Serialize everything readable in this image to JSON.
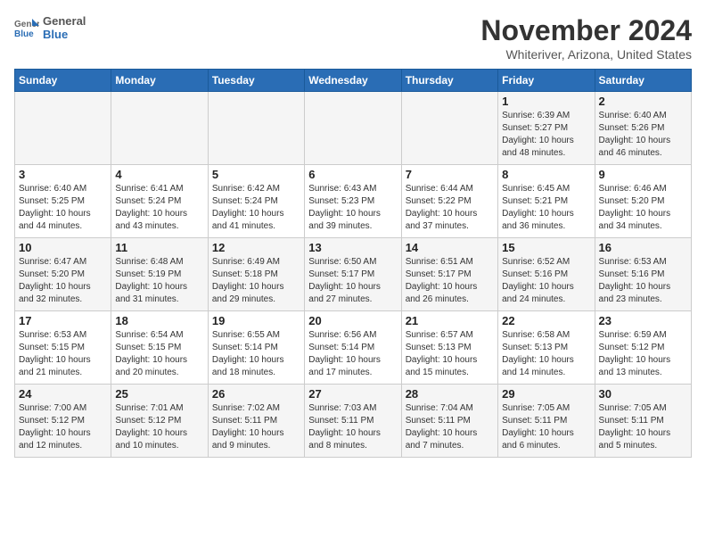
{
  "header": {
    "logo_general": "General",
    "logo_blue": "Blue",
    "month": "November 2024",
    "location": "Whiteriver, Arizona, United States"
  },
  "days_of_week": [
    "Sunday",
    "Monday",
    "Tuesday",
    "Wednesday",
    "Thursday",
    "Friday",
    "Saturday"
  ],
  "weeks": [
    [
      {
        "day": "",
        "info": ""
      },
      {
        "day": "",
        "info": ""
      },
      {
        "day": "",
        "info": ""
      },
      {
        "day": "",
        "info": ""
      },
      {
        "day": "",
        "info": ""
      },
      {
        "day": "1",
        "info": "Sunrise: 6:39 AM\nSunset: 5:27 PM\nDaylight: 10 hours and 48 minutes."
      },
      {
        "day": "2",
        "info": "Sunrise: 6:40 AM\nSunset: 5:26 PM\nDaylight: 10 hours and 46 minutes."
      }
    ],
    [
      {
        "day": "3",
        "info": "Sunrise: 6:40 AM\nSunset: 5:25 PM\nDaylight: 10 hours and 44 minutes."
      },
      {
        "day": "4",
        "info": "Sunrise: 6:41 AM\nSunset: 5:24 PM\nDaylight: 10 hours and 43 minutes."
      },
      {
        "day": "5",
        "info": "Sunrise: 6:42 AM\nSunset: 5:24 PM\nDaylight: 10 hours and 41 minutes."
      },
      {
        "day": "6",
        "info": "Sunrise: 6:43 AM\nSunset: 5:23 PM\nDaylight: 10 hours and 39 minutes."
      },
      {
        "day": "7",
        "info": "Sunrise: 6:44 AM\nSunset: 5:22 PM\nDaylight: 10 hours and 37 minutes."
      },
      {
        "day": "8",
        "info": "Sunrise: 6:45 AM\nSunset: 5:21 PM\nDaylight: 10 hours and 36 minutes."
      },
      {
        "day": "9",
        "info": "Sunrise: 6:46 AM\nSunset: 5:20 PM\nDaylight: 10 hours and 34 minutes."
      }
    ],
    [
      {
        "day": "10",
        "info": "Sunrise: 6:47 AM\nSunset: 5:20 PM\nDaylight: 10 hours and 32 minutes."
      },
      {
        "day": "11",
        "info": "Sunrise: 6:48 AM\nSunset: 5:19 PM\nDaylight: 10 hours and 31 minutes."
      },
      {
        "day": "12",
        "info": "Sunrise: 6:49 AM\nSunset: 5:18 PM\nDaylight: 10 hours and 29 minutes."
      },
      {
        "day": "13",
        "info": "Sunrise: 6:50 AM\nSunset: 5:17 PM\nDaylight: 10 hours and 27 minutes."
      },
      {
        "day": "14",
        "info": "Sunrise: 6:51 AM\nSunset: 5:17 PM\nDaylight: 10 hours and 26 minutes."
      },
      {
        "day": "15",
        "info": "Sunrise: 6:52 AM\nSunset: 5:16 PM\nDaylight: 10 hours and 24 minutes."
      },
      {
        "day": "16",
        "info": "Sunrise: 6:53 AM\nSunset: 5:16 PM\nDaylight: 10 hours and 23 minutes."
      }
    ],
    [
      {
        "day": "17",
        "info": "Sunrise: 6:53 AM\nSunset: 5:15 PM\nDaylight: 10 hours and 21 minutes."
      },
      {
        "day": "18",
        "info": "Sunrise: 6:54 AM\nSunset: 5:15 PM\nDaylight: 10 hours and 20 minutes."
      },
      {
        "day": "19",
        "info": "Sunrise: 6:55 AM\nSunset: 5:14 PM\nDaylight: 10 hours and 18 minutes."
      },
      {
        "day": "20",
        "info": "Sunrise: 6:56 AM\nSunset: 5:14 PM\nDaylight: 10 hours and 17 minutes."
      },
      {
        "day": "21",
        "info": "Sunrise: 6:57 AM\nSunset: 5:13 PM\nDaylight: 10 hours and 15 minutes."
      },
      {
        "day": "22",
        "info": "Sunrise: 6:58 AM\nSunset: 5:13 PM\nDaylight: 10 hours and 14 minutes."
      },
      {
        "day": "23",
        "info": "Sunrise: 6:59 AM\nSunset: 5:12 PM\nDaylight: 10 hours and 13 minutes."
      }
    ],
    [
      {
        "day": "24",
        "info": "Sunrise: 7:00 AM\nSunset: 5:12 PM\nDaylight: 10 hours and 12 minutes."
      },
      {
        "day": "25",
        "info": "Sunrise: 7:01 AM\nSunset: 5:12 PM\nDaylight: 10 hours and 10 minutes."
      },
      {
        "day": "26",
        "info": "Sunrise: 7:02 AM\nSunset: 5:11 PM\nDaylight: 10 hours and 9 minutes."
      },
      {
        "day": "27",
        "info": "Sunrise: 7:03 AM\nSunset: 5:11 PM\nDaylight: 10 hours and 8 minutes."
      },
      {
        "day": "28",
        "info": "Sunrise: 7:04 AM\nSunset: 5:11 PM\nDaylight: 10 hours and 7 minutes."
      },
      {
        "day": "29",
        "info": "Sunrise: 7:05 AM\nSunset: 5:11 PM\nDaylight: 10 hours and 6 minutes."
      },
      {
        "day": "30",
        "info": "Sunrise: 7:05 AM\nSunset: 5:11 PM\nDaylight: 10 hours and 5 minutes."
      }
    ]
  ]
}
